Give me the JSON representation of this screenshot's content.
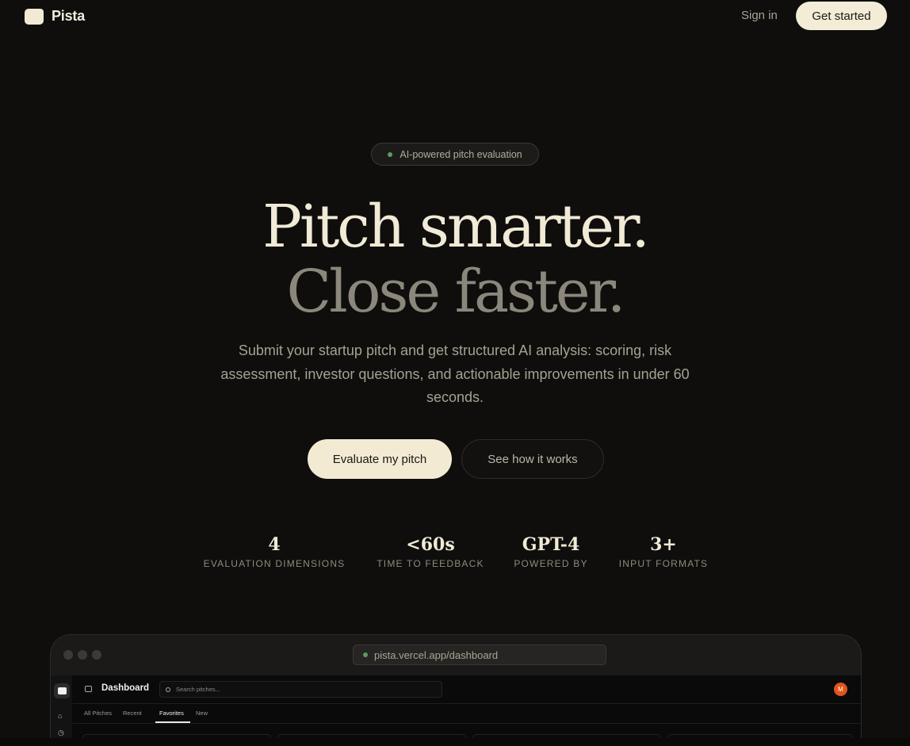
{
  "nav": {
    "brand": "Pista",
    "sign_in": "Sign in",
    "get_started": "Get started"
  },
  "hero": {
    "badge": "AI-powered pitch evaluation",
    "headline_1": "Pitch smarter.",
    "headline_2": "Close faster.",
    "subtext": "Submit your startup pitch and get structured AI analysis: scoring, risk assessment, investor questions, and actionable improvements in under 60 seconds.",
    "cta_primary": "Evaluate my pitch",
    "cta_secondary": "See how it works"
  },
  "stats": [
    {
      "value": "4",
      "label": "EVALUATION DIMENSIONS"
    },
    {
      "value": "<60s",
      "label": "TIME TO FEEDBACK"
    },
    {
      "value": "GPT-4",
      "label": "POWERED BY"
    },
    {
      "value": "3+",
      "label": "INPUT FORMATS"
    }
  ],
  "browser": {
    "url": "pista.vercel.app/dashboard",
    "app": {
      "title": "Dashboard",
      "search_placeholder": "Search pitches...",
      "avatar_initial": "M",
      "tabs": [
        "All Pitches",
        "Recent",
        "Favorites",
        "New"
      ],
      "active_tab": "Favorites"
    }
  },
  "colors": {
    "background": "#0f0e0d",
    "cream": "#f2ead3",
    "accent_green": "#5e9a62",
    "avatar_orange": "#e2541c"
  },
  "icons": {
    "logo": "rounded-square-logo",
    "badge_dot": "status-dot",
    "sidebar": [
      "home-icon",
      "clock-icon"
    ],
    "search": "search-icon",
    "panel": "sidebar-toggle-icon"
  }
}
